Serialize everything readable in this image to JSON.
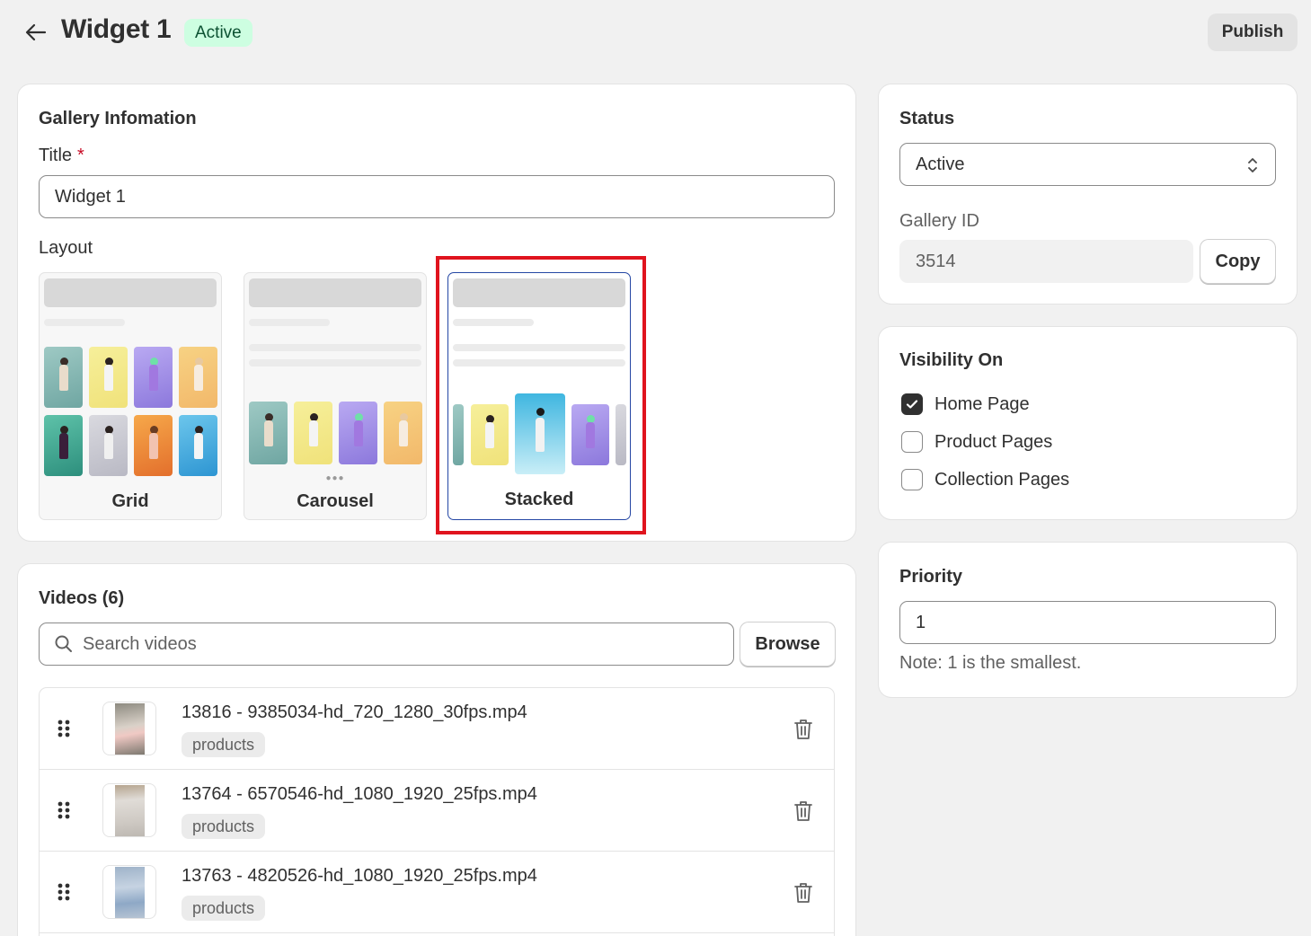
{
  "header": {
    "title": "Widget 1",
    "badge": "Active",
    "publish_label": "Publish"
  },
  "gallery_info": {
    "heading": "Gallery Infomation",
    "title_label": "Title",
    "required_mark": "*",
    "title_value": "Widget 1",
    "layout_label": "Layout",
    "layouts": [
      {
        "label": "Grid",
        "selected": false
      },
      {
        "label": "Carousel",
        "selected": false
      },
      {
        "label": "Stacked",
        "selected": true
      }
    ]
  },
  "videos": {
    "heading": "Videos (6)",
    "search_placeholder": "Search videos",
    "browse_label": "Browse",
    "items": [
      {
        "name": "13816 - 9385034-hd_720_1280_30fps.mp4",
        "tag": "products"
      },
      {
        "name": "13764 - 6570546-hd_1080_1920_25fps.mp4",
        "tag": "products"
      },
      {
        "name": "13763 - 4820526-hd_1080_1920_25fps.mp4",
        "tag": "products"
      }
    ]
  },
  "status": {
    "heading": "Status",
    "selected": "Active",
    "gallery_id_label": "Gallery ID",
    "gallery_id": "3514",
    "copy_label": "Copy"
  },
  "visibility": {
    "heading": "Visibility On",
    "options": [
      {
        "label": "Home Page",
        "checked": true
      },
      {
        "label": "Product Pages",
        "checked": false
      },
      {
        "label": "Collection Pages",
        "checked": false
      }
    ]
  },
  "priority": {
    "heading": "Priority",
    "value": "1",
    "note": "Note: 1 is the smallest."
  },
  "colors": {
    "accent_border": "#2547a4",
    "highlight": "#e0141e",
    "badge_bg": "#cdfee1",
    "badge_text": "#0c5132"
  }
}
